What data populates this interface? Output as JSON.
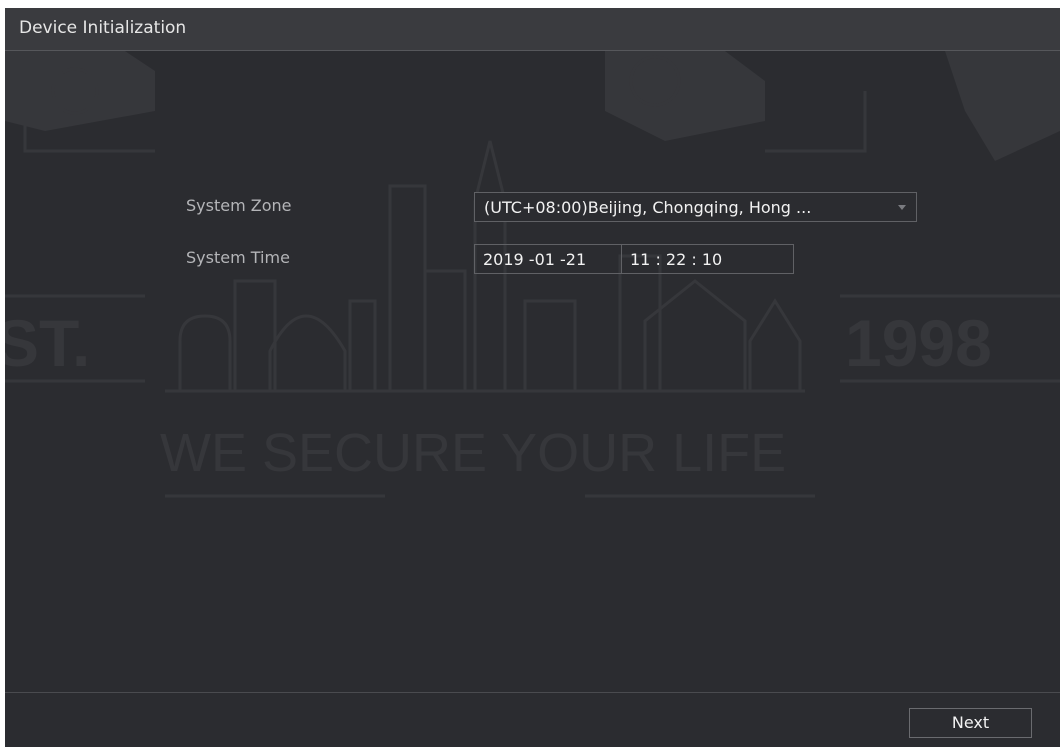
{
  "window": {
    "title": "Device Initialization"
  },
  "watermark": {
    "left_text": "ST.",
    "right_text": "1998",
    "slogan": "WE SECURE YOUR LIFE"
  },
  "form": {
    "system_zone_label": "System Zone",
    "system_zone_value": "(UTC+08:00)Beijing, Chongqing, Hong ...",
    "system_time_label": "System Time",
    "date_value": "2019 -01 -21",
    "time_value": "11 : 22 : 10"
  },
  "footer": {
    "next_label": "Next"
  },
  "colors": {
    "background": "#2b2c30",
    "titlebar": "#3a3b3f",
    "text": "#f2f2f2",
    "label": "#b4b5b8",
    "border": "#606165"
  }
}
